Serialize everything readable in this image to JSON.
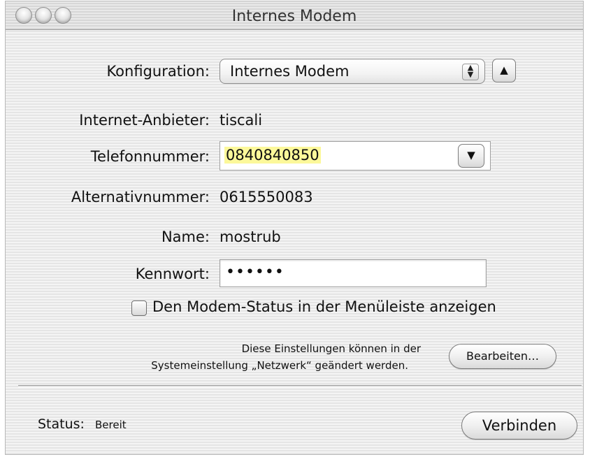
{
  "window": {
    "title": "Internes Modem"
  },
  "form": {
    "configuration_label": "Konfiguration:",
    "configuration_value": "Internes Modem",
    "provider_label": "Internet-Anbieter:",
    "provider_value": "tiscali",
    "phone_label": "Telefonnummer:",
    "phone_value": "0840840850",
    "alt_label": "Alternativnummer:",
    "alt_value": "0615550083",
    "name_label": "Name:",
    "name_value": "mostrub",
    "password_label": "Kennwort:",
    "password_value": "••••••",
    "menu_status_checkbox_label": "Den Modem-Status in der Menüleiste anzeigen",
    "menu_status_checked": false
  },
  "info": {
    "line1": "Diese Einstellungen können in der",
    "line2": "Systemeinstellung „Netzwerk“ geändert werden.",
    "edit_button": "Bearbeiten…"
  },
  "footer": {
    "status_label": "Status:",
    "status_value": "Bereit",
    "connect_button": "Verbinden"
  },
  "icons": {
    "popup_arrows": "up-down-arrows-icon",
    "collapse": "triangle-up-icon",
    "combo_dropdown": "triangle-down-icon"
  },
  "colors": {
    "phone_highlight": "#fcf89a"
  }
}
